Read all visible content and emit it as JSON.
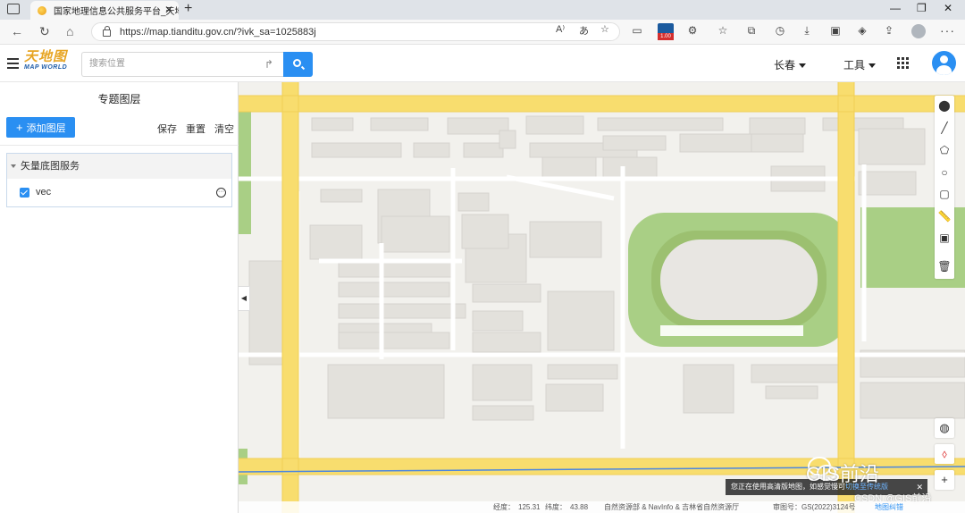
{
  "browser": {
    "tab_title": "国家地理信息公共服务平台_天地",
    "tab_close": "✕",
    "new_tab": "+",
    "url": "https://map.tianditu.gov.cn/?ivk_sa=1025883j",
    "ext_badge_count": "1.00",
    "window_controls": {
      "minimize": "—",
      "restore": "❐",
      "close": "✕"
    }
  },
  "header": {
    "logo_cn": "天地图",
    "logo_en": "MAP WORLD",
    "search_placeholder": "搜索位置",
    "city": "长春",
    "tools": "工具"
  },
  "panel": {
    "title": "专题图层",
    "add_layer": "添加图层",
    "save": "保存",
    "reset": "重置",
    "clear": "清空",
    "group": {
      "name": "矢量底图服务",
      "layers": [
        {
          "name": "vec",
          "checked": true
        }
      ]
    }
  },
  "map": {
    "hd_notice": "您正在使用高清版地图，如感觉慢可",
    "hd_link": "切换至传统版",
    "status": {
      "lon_label": "经度：",
      "lon": "125.31",
      "lat_label": "纬度：",
      "lat": "43.88",
      "attribution": "自然资源部 & NavInfo & 吉林省自然资源厅",
      "review_no": "审图号：GS(2022)3124号",
      "correction": "地图纠错"
    },
    "watermark": "GIS前沿",
    "csdn": "CSDN @GIS前沿"
  },
  "colors": {
    "accent": "#2a8ff2",
    "road_major": "#f8dd6e",
    "road_minor": "#ffffff",
    "building": "#e4e2de",
    "green": "#a9cf85",
    "map_bg": "#f2f1ed"
  }
}
